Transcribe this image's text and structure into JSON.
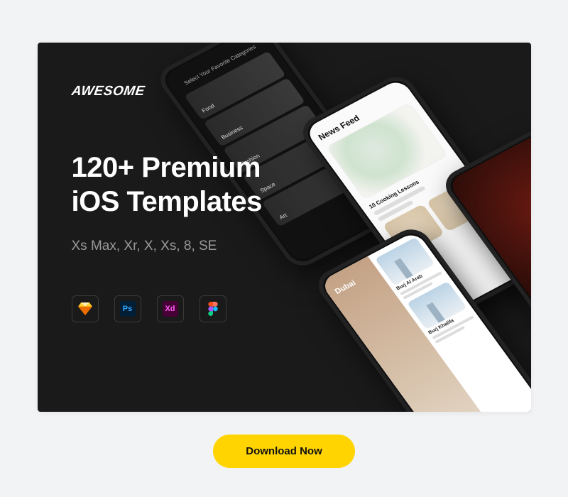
{
  "banner": {
    "brand": "AWESOME",
    "headline_line1": "120+ Premium",
    "headline_line2": "iOS Templates",
    "subline": "Xs Max, Xr, X, Xs, 8, SE",
    "tools": {
      "sketch": "sketch-icon",
      "photoshop_label": "Ps",
      "xd_label": "Xd",
      "figma": "figma-icon"
    }
  },
  "mockups": {
    "phone1": {
      "title": "Select Your Favorite Categories",
      "categories": [
        "Food",
        "Business",
        "Fashion",
        "Space",
        "Art"
      ]
    },
    "phone2": {
      "title": "News Feed",
      "article_title": "10 Cooking Lessons"
    },
    "phone4": {
      "city": "Dubai",
      "items": [
        "Burj Al Arab",
        "Burj Khalifa"
      ]
    }
  },
  "cta": {
    "label": "Download Now"
  }
}
